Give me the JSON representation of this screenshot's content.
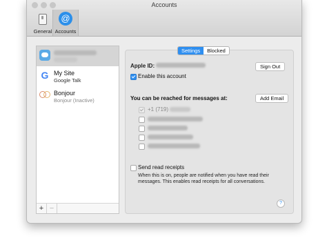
{
  "window": {
    "title": "Accounts"
  },
  "toolbar": {
    "general_label": "General",
    "accounts_label": "Accounts"
  },
  "accounts": [
    {
      "name": "",
      "service": "iMessage",
      "selected": true,
      "icon": "messages-icon"
    },
    {
      "name": "My Site",
      "service": "Google Talk",
      "selected": false,
      "icon": "google-icon"
    },
    {
      "name": "Bonjour",
      "service": "Bonjour (Inactive)",
      "selected": false,
      "icon": "bonjour-icon"
    }
  ],
  "sidebar_footer": {
    "add_label": "+",
    "remove_label": "−"
  },
  "tabs": [
    {
      "label": "Settings",
      "active": true
    },
    {
      "label": "Blocked",
      "active": false
    }
  ],
  "settings": {
    "apple_id_label": "Apple ID:",
    "sign_out_label": "Sign Out",
    "enable_label": "Enable this account",
    "enable_checked": true,
    "reach_label": "You can be reached for messages at:",
    "add_email_label": "Add Email",
    "addresses": [
      {
        "text": "+1 (719)",
        "checked": true
      }
    ],
    "read_receipts_label": "Send read receipts",
    "read_receipts_desc": "When this is on, people are notified when you have read their messages. This enables read receipts for all conversations.",
    "help_label": "?"
  },
  "colors": {
    "accent": "#2f8ff0"
  }
}
